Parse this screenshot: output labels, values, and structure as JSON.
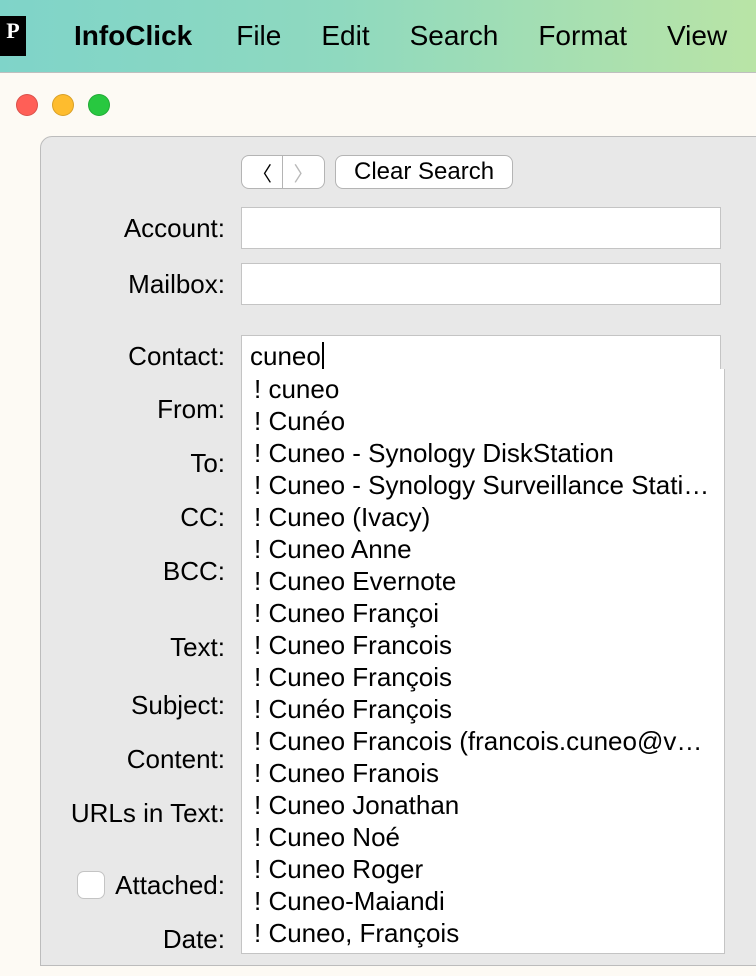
{
  "menubar": {
    "app_name": "InfoClick",
    "items": [
      "File",
      "Edit",
      "Search",
      "Format",
      "View"
    ]
  },
  "toolbar": {
    "clear_label": "Clear Search"
  },
  "labels": {
    "account": "Account:",
    "mailbox": "Mailbox:",
    "contact": "Contact:",
    "from": "From:",
    "to": "To:",
    "cc": "CC:",
    "bcc": "BCC:",
    "text": "Text:",
    "subject": "Subject:",
    "content": "Content:",
    "urls": "URLs in Text:",
    "attached": "Attached:",
    "date": "Date:"
  },
  "fields": {
    "account": "",
    "mailbox": "",
    "contact": "cuneo"
  },
  "suggestions": [
    "! cuneo",
    "! Cunéo",
    "! Cuneo - Synology DiskStation",
    "! Cuneo - Synology Surveillance Station",
    "! Cuneo (Ivacy)",
    "! Cuneo Anne",
    "! Cuneo Evernote",
    "! Cuneo Françoi",
    "! Cuneo Francois",
    "! Cuneo François",
    "! Cunéo François",
    "! Cuneo Francois (francois.cuneo@vd.ed…",
    "! Cuneo Franois",
    "! Cuneo Jonathan",
    "! Cuneo Noé",
    "! Cuneo Roger",
    "! Cuneo-Maiandi",
    "! Cuneo, François"
  ]
}
